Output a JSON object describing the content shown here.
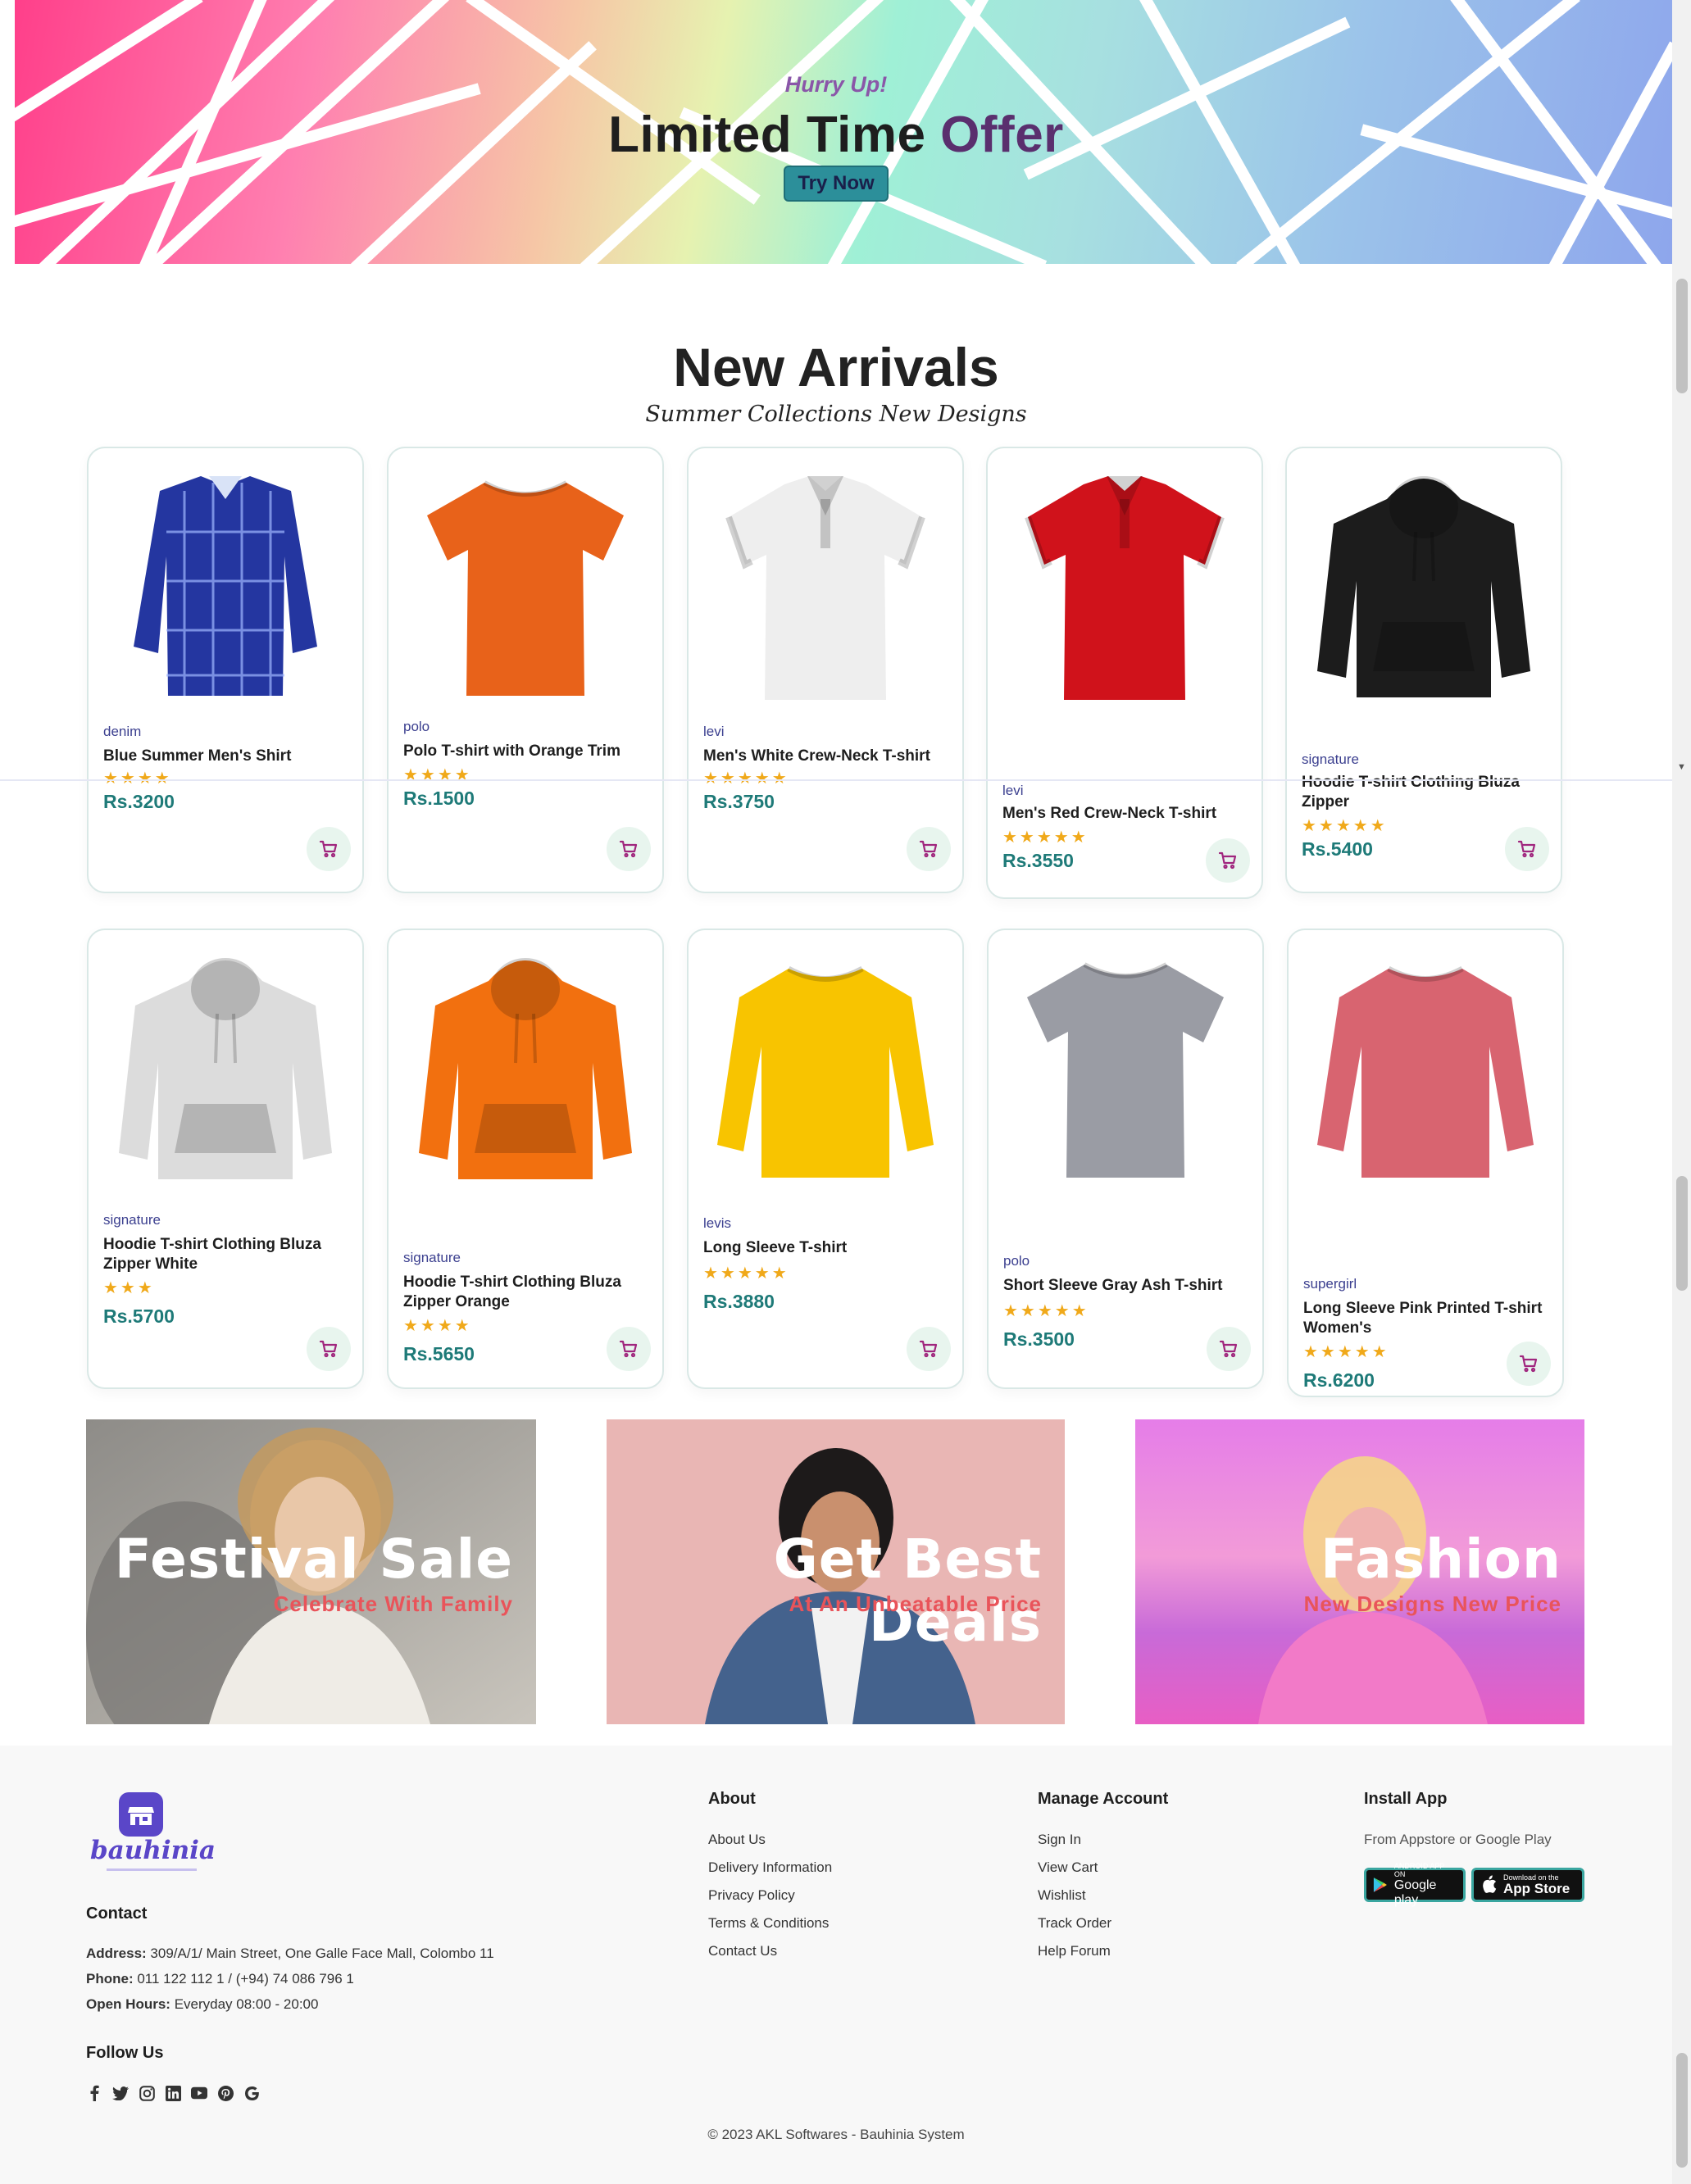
{
  "banner": {
    "eyebrow": "Hurry Up!",
    "title_main": "Limited Time",
    "title_accent": "Offer",
    "cta": "Try Now"
  },
  "arrivals": {
    "title": "New Arrivals",
    "subtitle": "Summer Collections New Designs"
  },
  "products": [
    {
      "brand": "denim",
      "name": "Blue Summer Men's Shirt",
      "rating": 4,
      "price": "Rs.3200",
      "color": "#2436a0"
    },
    {
      "brand": "polo",
      "name": "Polo T-shirt with Orange Trim",
      "rating": 4,
      "price": "Rs.1500",
      "color": "#e8621a"
    },
    {
      "brand": "levi",
      "name": "Men's White Crew-Neck T-shirt",
      "rating": 5,
      "price": "Rs.3750",
      "color": "#eeeeee"
    },
    {
      "brand": "levi",
      "name": "Men's Red Crew-Neck T-shirt",
      "rating": 5,
      "price": "Rs.3550",
      "color": "#d0121b"
    },
    {
      "brand": "signature",
      "name": "Hoodie T-shirt Clothing Bluza Zipper",
      "rating": 5,
      "price": "Rs.5400",
      "color": "#1c1c1c"
    },
    {
      "brand": "signature",
      "name": "Hoodie T-shirt Clothing Bluza Zipper White",
      "rating": 3,
      "price": "Rs.5700",
      "color": "#dcdcdc"
    },
    {
      "brand": "signature",
      "name": "Hoodie T-shirt Clothing Bluza Zipper Orange",
      "rating": 4,
      "price": "Rs.5650",
      "color": "#f2700f"
    },
    {
      "brand": "levis",
      "name": "Long Sleeve T-shirt",
      "rating": 5,
      "price": "Rs.3880",
      "color": "#f8c400"
    },
    {
      "brand": "polo",
      "name": "Short Sleeve Gray Ash T-shirt",
      "rating": 5,
      "price": "Rs.3500",
      "color": "#9a9ca4"
    },
    {
      "brand": "supergirl",
      "name": "Long Sleeve Pink Printed T-shirt Women's",
      "rating": 5,
      "price": "Rs.6200",
      "color": "#d86470"
    }
  ],
  "promos": [
    {
      "title": "Festival Sale",
      "subtitle": "Celebrate With Family"
    },
    {
      "title": "Get Best Deals",
      "subtitle": "At An Unbeatable Price"
    },
    {
      "title": "Fashion",
      "subtitle": "New Designs New Price"
    }
  ],
  "footer": {
    "logo_text": "bauhinia",
    "contact_heading": "Contact",
    "address_label": "Address:",
    "address": "309/A/1/ Main Street, One Galle Face Mall, Colombo 11",
    "phone_label": "Phone:",
    "phone": "011 122 112 1 / (+94) 74 086 796 1",
    "hours_label": "Open Hours:",
    "hours": "Everyday 08:00 - 20:00",
    "follow_heading": "Follow Us",
    "about_heading": "About",
    "about_links": [
      "About Us",
      "Delivery Information",
      "Privacy Policy",
      "Terms & Conditions",
      "Contact Us"
    ],
    "account_heading": "Manage Account",
    "account_links": [
      "Sign In",
      "View Cart",
      "Wishlist",
      "Track Order",
      "Help Forum"
    ],
    "app_heading": "Install App",
    "app_text": "From Appstore or Google Play",
    "google_small": "ANDROID APP ON",
    "google_big": "Google play",
    "apple_small": "Download on the",
    "apple_big": "App Store",
    "copyright": "© 2023 AKL Softwares - Bauhinia System"
  },
  "colors": {
    "accent_teal": "#1e7a78",
    "brand_purple": "#5a46c8",
    "cart_icon": "#a0267e",
    "star": "#f0a91a"
  }
}
